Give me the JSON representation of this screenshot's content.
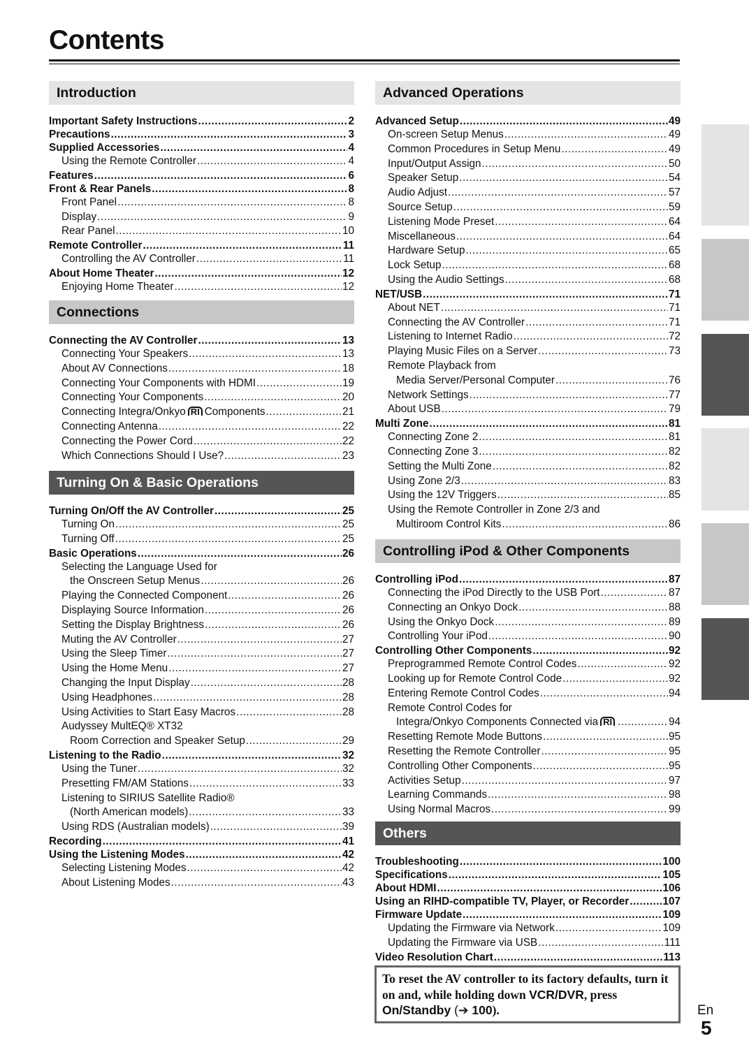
{
  "title": "Contents",
  "left": [
    {
      "heading": "Introduction",
      "style": "light",
      "entries": [
        {
          "l": 0,
          "t": "Important Safety Instructions",
          "p": "2"
        },
        {
          "l": 0,
          "t": "Precautions",
          "p": "3"
        },
        {
          "l": 0,
          "t": "Supplied Accessories",
          "p": "4"
        },
        {
          "l": 1,
          "t": "Using the Remote Controller",
          "p": "4"
        },
        {
          "l": 0,
          "t": "Features",
          "p": "6"
        },
        {
          "l": 0,
          "t": "Front & Rear Panels",
          "p": "8"
        },
        {
          "l": 1,
          "t": "Front Panel",
          "p": "8"
        },
        {
          "l": 1,
          "t": "Display",
          "p": "9"
        },
        {
          "l": 1,
          "t": "Rear Panel",
          "p": "10"
        },
        {
          "l": 0,
          "t": "Remote Controller",
          "p": "11"
        },
        {
          "l": 1,
          "t": "Controlling the AV Controller",
          "p": "11"
        },
        {
          "l": 0,
          "t": "About Home Theater",
          "p": "12"
        },
        {
          "l": 1,
          "t": "Enjoying Home Theater",
          "p": "12"
        }
      ]
    },
    {
      "heading": "Connections",
      "style": "mid",
      "entries": [
        {
          "l": 0,
          "t": "Connecting the AV Controller",
          "p": "13"
        },
        {
          "l": 1,
          "t": "Connecting Your Speakers",
          "p": "13"
        },
        {
          "l": 1,
          "t": "About AV Connections",
          "p": "18"
        },
        {
          "l": 1,
          "t": "Connecting Your Components with HDMI",
          "p": "19"
        },
        {
          "l": 1,
          "t": "Connecting Your Components",
          "p": "20"
        },
        {
          "l": 1,
          "t": "Connecting Integra/Onkyo",
          "logo": "RI",
          "t2": "Components",
          "p": "21"
        },
        {
          "l": 1,
          "t": "Connecting Antenna",
          "p": "22"
        },
        {
          "l": 1,
          "t": "Connecting the Power Cord",
          "p": "22"
        },
        {
          "l": 1,
          "t": "Which Connections Should I Use?",
          "p": "23"
        }
      ]
    },
    {
      "heading": "Turning On & Basic Operations",
      "style": "dark",
      "entries": [
        {
          "l": 0,
          "t": "Turning On/Off the AV Controller",
          "p": "25"
        },
        {
          "l": 1,
          "t": "Turning On",
          "p": "25"
        },
        {
          "l": 1,
          "t": "Turning Off",
          "p": "25"
        },
        {
          "l": 0,
          "t": "Basic Operations",
          "p": "26"
        },
        {
          "l": 1,
          "t": "Selecting the Language Used for"
        },
        {
          "l": 2,
          "t": "the Onscreen Setup Menus",
          "p": "26"
        },
        {
          "l": 1,
          "t": "Playing the Connected Component",
          "p": "26"
        },
        {
          "l": 1,
          "t": "Displaying Source Information",
          "p": "26"
        },
        {
          "l": 1,
          "t": "Setting the Display Brightness",
          "p": "26"
        },
        {
          "l": 1,
          "t": "Muting the AV Controller",
          "p": "27"
        },
        {
          "l": 1,
          "t": "Using the Sleep Timer",
          "p": "27"
        },
        {
          "l": 1,
          "t": "Using the Home Menu",
          "p": "27"
        },
        {
          "l": 1,
          "t": "Changing the Input Display",
          "p": "28"
        },
        {
          "l": 1,
          "t": "Using Headphones",
          "p": "28"
        },
        {
          "l": 1,
          "t": "Using Activities to Start Easy Macros",
          "p": "28"
        },
        {
          "l": 1,
          "t": "Audyssey MultEQ® XT32"
        },
        {
          "l": 2,
          "t": "Room Correction and Speaker Setup",
          "p": "29"
        },
        {
          "l": 0,
          "t": "Listening to the Radio",
          "p": "32"
        },
        {
          "l": 1,
          "t": "Using the Tuner",
          "p": "32"
        },
        {
          "l": 1,
          "t": "Presetting FM/AM Stations",
          "p": "33"
        },
        {
          "l": 1,
          "t": "Listening to SIRIUS Satellite Radio®"
        },
        {
          "l": 2,
          "t": "(North American models)",
          "p": "33"
        },
        {
          "l": 1,
          "t": "Using RDS (Australian models)",
          "p": "39"
        },
        {
          "l": 0,
          "t": "Recording",
          "p": "41"
        },
        {
          "l": 0,
          "t": "Using the Listening Modes",
          "p": "42"
        },
        {
          "l": 1,
          "t": "Selecting Listening Modes",
          "p": "42"
        },
        {
          "l": 1,
          "t": "About Listening Modes",
          "p": "43"
        }
      ]
    }
  ],
  "right": [
    {
      "heading": "Advanced Operations",
      "style": "light",
      "entries": [
        {
          "l": 0,
          "t": "Advanced Setup",
          "p": "49"
        },
        {
          "l": 1,
          "t": "On-screen Setup Menus",
          "p": "49"
        },
        {
          "l": 1,
          "t": "Common Procedures in Setup Menu",
          "p": "49"
        },
        {
          "l": 1,
          "t": "Input/Output Assign",
          "p": "50"
        },
        {
          "l": 1,
          "t": "Speaker Setup",
          "p": "54"
        },
        {
          "l": 1,
          "t": "Audio Adjust",
          "p": "57"
        },
        {
          "l": 1,
          "t": "Source Setup",
          "p": "59"
        },
        {
          "l": 1,
          "t": "Listening Mode Preset",
          "p": "64"
        },
        {
          "l": 1,
          "t": "Miscellaneous",
          "p": "64"
        },
        {
          "l": 1,
          "t": "Hardware Setup",
          "p": "65"
        },
        {
          "l": 1,
          "t": "Lock Setup",
          "p": "68"
        },
        {
          "l": 1,
          "t": "Using the Audio Settings",
          "p": "68"
        },
        {
          "l": 0,
          "t": "NET/USB",
          "p": "71"
        },
        {
          "l": 1,
          "t": "About NET",
          "p": "71"
        },
        {
          "l": 1,
          "t": "Connecting the AV Controller",
          "p": "71"
        },
        {
          "l": 1,
          "t": "Listening to Internet Radio",
          "p": "72"
        },
        {
          "l": 1,
          "t": "Playing Music Files on a Server",
          "p": "73"
        },
        {
          "l": 1,
          "t": "Remote Playback from"
        },
        {
          "l": 2,
          "t": "Media Server/Personal Computer",
          "p": "76"
        },
        {
          "l": 1,
          "t": "Network Settings",
          "p": "77"
        },
        {
          "l": 1,
          "t": "About USB",
          "p": "79"
        },
        {
          "l": 0,
          "t": "Multi Zone",
          "p": "81"
        },
        {
          "l": 1,
          "t": "Connecting Zone 2",
          "p": "81"
        },
        {
          "l": 1,
          "t": "Connecting Zone 3",
          "p": "82"
        },
        {
          "l": 1,
          "t": "Setting the Multi Zone",
          "p": "82"
        },
        {
          "l": 1,
          "t": "Using Zone 2/3",
          "p": "83"
        },
        {
          "l": 1,
          "t": "Using the 12V Triggers",
          "p": "85"
        },
        {
          "l": 1,
          "t": "Using the Remote Controller in Zone 2/3 and"
        },
        {
          "l": 2,
          "t": "Multiroom Control Kits",
          "p": "86"
        }
      ]
    },
    {
      "heading": "Controlling iPod & Other Components",
      "style": "mid",
      "entries": [
        {
          "l": 0,
          "t": "Controlling iPod",
          "p": "87"
        },
        {
          "l": 1,
          "t": "Connecting the iPod Directly to the USB Port",
          "p": "87"
        },
        {
          "l": 1,
          "t": "Connecting an Onkyo Dock",
          "p": "88"
        },
        {
          "l": 1,
          "t": "Using the Onkyo Dock",
          "p": "89"
        },
        {
          "l": 1,
          "t": "Controlling Your iPod",
          "p": "90"
        },
        {
          "l": 0,
          "t": "Controlling Other Components",
          "p": "92"
        },
        {
          "l": 1,
          "t": "Preprogrammed Remote Control Codes",
          "p": "92"
        },
        {
          "l": 1,
          "t": "Looking up for Remote Control Code",
          "p": "92"
        },
        {
          "l": 1,
          "t": "Entering Remote Control Codes",
          "p": "94"
        },
        {
          "l": 1,
          "t": "Remote Control Codes for"
        },
        {
          "l": 2,
          "t": "Integra/Onkyo Components Connected via",
          "logo": "RI",
          "p": "94"
        },
        {
          "l": 1,
          "t": "Resetting Remote Mode Buttons",
          "p": "95"
        },
        {
          "l": 1,
          "t": "Resetting the Remote Controller",
          "p": "95"
        },
        {
          "l": 1,
          "t": "Controlling Other Components",
          "p": "95"
        },
        {
          "l": 1,
          "t": "Activities Setup",
          "p": "97"
        },
        {
          "l": 1,
          "t": "Learning Commands",
          "p": "98"
        },
        {
          "l": 1,
          "t": "Using Normal Macros",
          "p": "99"
        }
      ]
    },
    {
      "heading": "Others",
      "style": "dark",
      "entries": [
        {
          "l": 0,
          "t": "Troubleshooting",
          "p": "100"
        },
        {
          "l": 0,
          "t": "Specifications",
          "p": "105"
        },
        {
          "l": 0,
          "t": "About HDMI",
          "p": "106"
        },
        {
          "l": 0,
          "t": "Using an RIHD-compatible TV, Player, or Recorder",
          "p": "107"
        },
        {
          "l": 0,
          "t": "Firmware Update",
          "p": "109"
        },
        {
          "l": 1,
          "t": "Updating the Firmware via Network",
          "p": "109"
        },
        {
          "l": 1,
          "t": "Updating the Firmware via USB",
          "p": "111"
        },
        {
          "l": 0,
          "t": "Video Resolution Chart",
          "p": "113"
        }
      ]
    }
  ],
  "note": {
    "line1": "To reset the AV controller to its factory defaults, turn it on and, while holding down ",
    "key1": "VCR/DVR",
    "mid": ", press ",
    "key2": "On/Standby",
    "arrow": " (➔ ",
    "ref": "100",
    "end": ")."
  },
  "footer": {
    "lang": "En",
    "page": "5"
  },
  "tabs": [
    "light",
    "mid",
    "dark",
    "light",
    "mid",
    "dark"
  ],
  "colors": {
    "light": "#e4e4e4",
    "mid": "#c7c7c7",
    "dark": "#555555"
  }
}
